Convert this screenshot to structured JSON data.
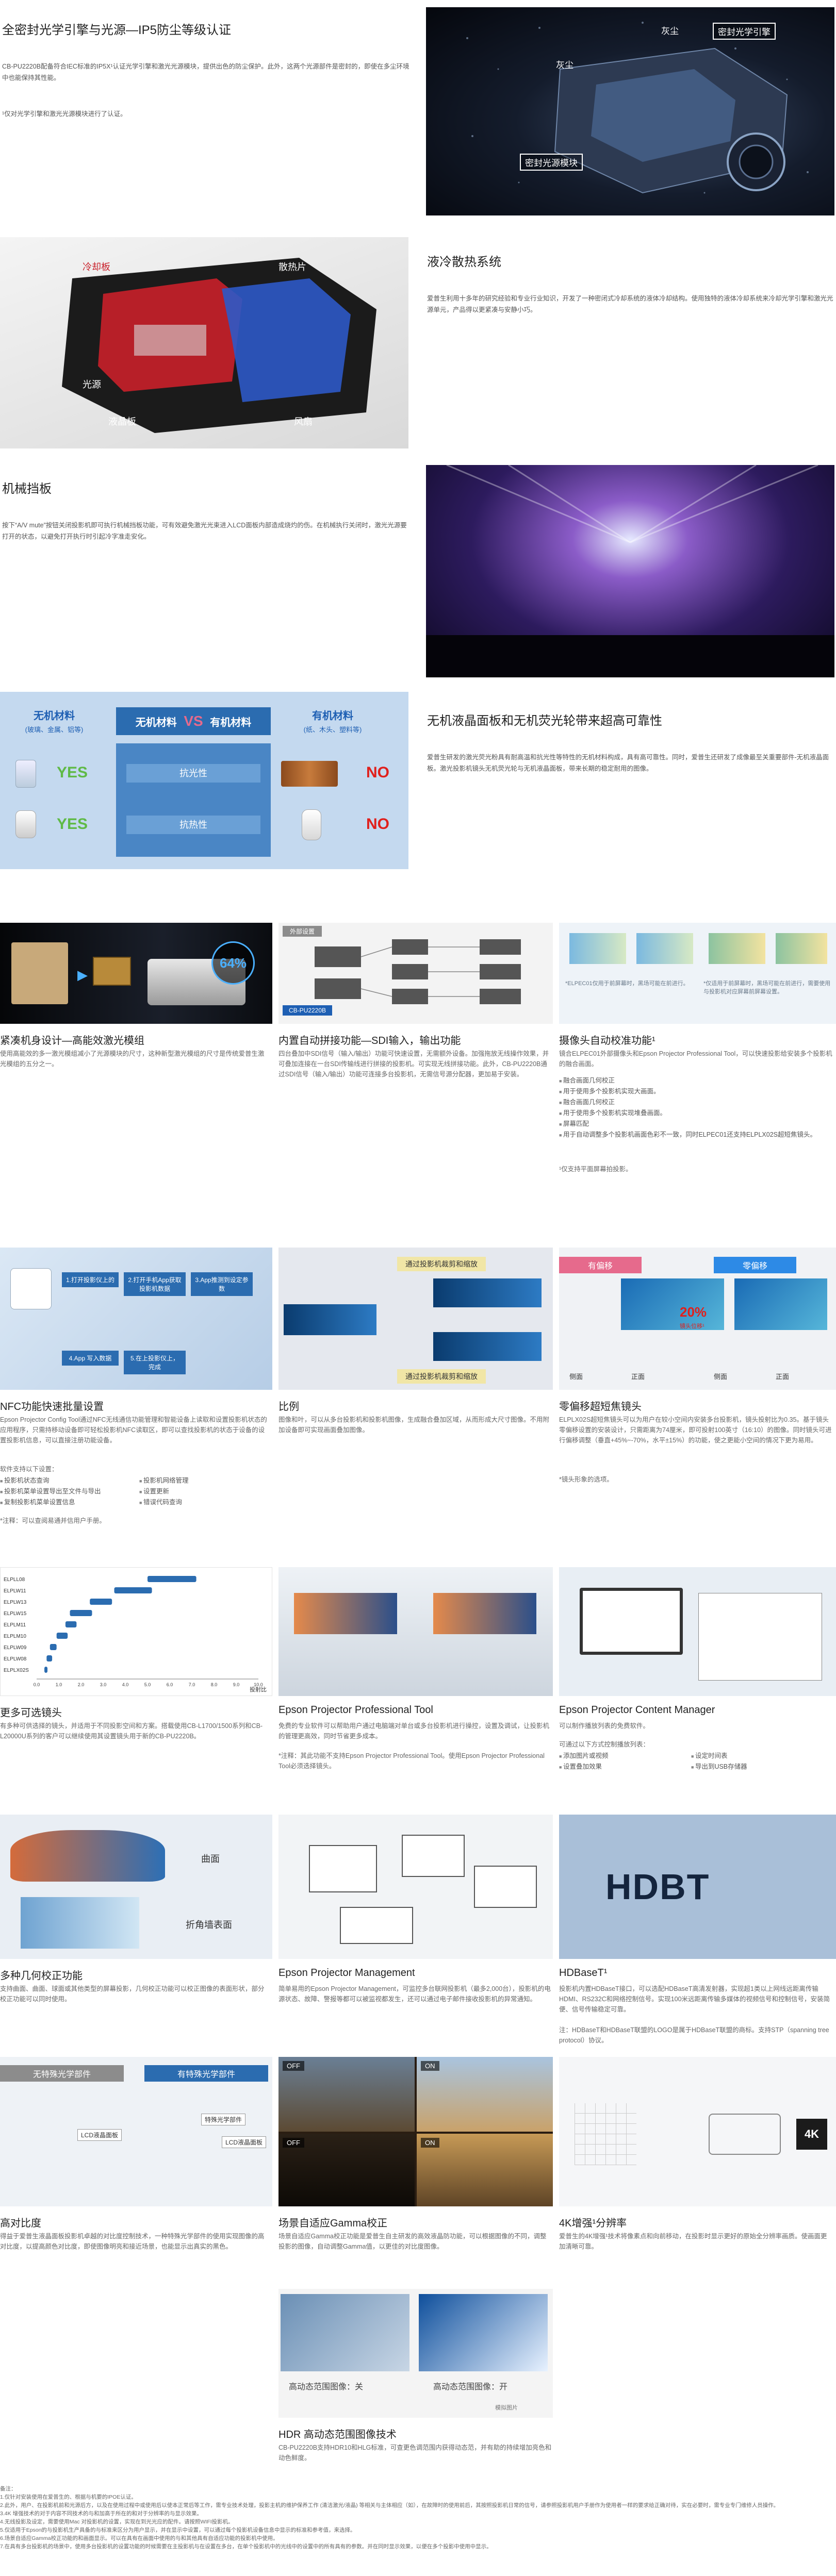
{
  "sec1": {
    "title": "全密封光学引擎与光源—IP5防尘等级认证",
    "body": "CB-PU2220B配备符合IEC标准的IP5X¹认证光学引擎和激光光源模块，提供出色的防尘保护。此外，这两个光源部件是密封的，即使在多尘环境中也能保持其性能。",
    "note": "¹仅对光学引擎和激光光源模块进行了认证。",
    "labels": [
      "灰尘",
      "密封光学引擎",
      "灰尘",
      "密封光源模块"
    ]
  },
  "sec2": {
    "title": "液冷散热系统",
    "body": "爱普生利用十多年的研究经验和专业行业知识，开发了一种密闭式冷却系统的液体冷却结构。使用独特的液体冷却系统来冷却光学引擎和激光光源单元，产品得以更紧凑与安静小巧。",
    "labels": [
      "冷却板",
      "散热片",
      "光源",
      "液晶板",
      "风扇"
    ]
  },
  "sec3": {
    "title": "机械挡板",
    "body": "按下“A/V mute”按钮关闭投影机即可执行机械挡板功能，可有效避免激光光束进入LCD面板内部造成烧灼的伤。在机械执行关闭时，激光光源要打开的状态，以避免打开执行时引起冷字准走安化。"
  },
  "sec4": {
    "title": "无机液晶面板和无机荧光轮带来超高可靠性",
    "body": "爱普生研发的激光荧光粉具有耐高温和抗光性等特性的无机材料构成，具有高可靠性。同时，爱普生还研发了成像最至关重要部件-无机液晶面板。激光投影机镜头无机荧光轮与无机液晶面板，带来长期的稳定耐用的图像。",
    "left_head": "无机材料",
    "left_sub": "(玻璃、金属、铝等)",
    "mid_head_a": "无机材料",
    "mid_head_vs": "VS",
    "mid_head_b": "有机材料",
    "right_head": "有机材料",
    "right_sub": "(纸、木头、塑料等)",
    "row1": "抗光性",
    "row2": "抗热性",
    "yes": "YES",
    "no": "NO"
  },
  "feat_row1": [
    {
      "title": "紧凑机身设计—高能效激光模组",
      "body": "使用高能效的多一激光模组减小了光源模块的尺寸，这种新型激光模组的尺寸是传统爱普生激光模组的五分之一。",
      "badge": "64%"
    },
    {
      "title": "内置自动拼接功能—SDI输入，输出功能",
      "body": "四台叠加中SDI信号（输入/输出）功能可快速设置，无需额外设备。加强拖放无线操作效果，并可叠加连接在一台SDI传输线进行拼接的投影机。可实现无线拼接功能。此外，CB-PU2220B通过SDI信号（输入/输出）功能可连接多台投影机，无需信号源分配器，更加易于安装。",
      "panel_top": "外部设置",
      "panel_model": "CB-PU2220B"
    },
    {
      "title": "摄像头自动校准功能¹",
      "body": "镜合ELPEC01外部摄像头和Epson Projector Professional Tool，可以快速投影给安装多个投影机的融合画面。",
      "bullets": [
        "融合画面几何校正",
        "用于使用多个投影机实现大画面。",
        "融合画面几何校正",
        "用于使用多个投影机实现堆叠画面。",
        "屏幕匹配",
        "用于自动调整多个投影机画面色彩不一致，同时ELPEC01还支持ELPLX02S超短焦镜头。"
      ],
      "note": "¹仅支持平面屏幕拍投影。",
      "captions": [
        "*ELPEC01仅用于前屏幕时，黑场可能在前进行。",
        "*仅适用于前屏幕时，黑场可能在前进行，需要使用与投影机对应屏幕前屏幕设置。"
      ]
    }
  ],
  "feat_row2": [
    {
      "title": "NFC功能快速批量设置",
      "body": "Epson Projector Config Tool通过NFC无线通信功能管理和智能设备上读取和设置投影机状态的应用程序，只需持移动设备即可轻松投影机NFC读取区，即可以查找投影机的状态于设备的设置投影机信息，可以直接注册功能设备。",
      "list_head": "软件支持以下设置：",
      "bullets": [
        "投影机状态查询",
        "投影机菜单设置导出至文件与导出",
        "复制投影机菜单设置信息",
        "投影机网络管理",
        "设置更新",
        "错误代码查询"
      ],
      "note": "*注释：可以查阅易通并信用户手册。",
      "steps": [
        "1.打开投影仪上的",
        "2.打开手机App获取投影机数据",
        "3.App推测到设定参数",
        "4.App 写入数据",
        "5.在上投影仪上，完成"
      ]
    },
    {
      "title": "比例",
      "body": "图像和叶，可以从多台投影机和投影机图像，生成融合叠加区域，从而形成大尺寸图像。不用附加设备即可实现画面叠加图像。",
      "tags": [
        "通过投影机裁剪和缩放",
        "通过投影机裁剪和缩放"
      ]
    },
    {
      "title": "零偏移超短焦镜头",
      "body": "ELPLX02S超短焦镜头可以为用户在较小空间内安装多台投影机，镜头投射比为0.35。基于镜头零偏移设置的安装设计，只需距离为74厘米，即可投射100英寸（16:10）的图像。同时镜头可进行偏移调整（垂直+45%~-70%，水平±15%）的功能，使之更能小空间的情况下更为易用。",
      "note": "*镜头形象的选项。",
      "tabs": [
        "有偏移",
        "零偏移"
      ],
      "percent": "20%",
      "percent_sub": "镜头位移¹",
      "labels": [
        "侧面",
        "正面",
        "侧面",
        "正面"
      ]
    }
  ],
  "feat_row3": [
    {
      "title": "更多可选镜头",
      "body": "有多种可供选择的镜头，并适用于不同投影空间和方案。搭载使用CB-L1700/1500系列和CB-L20000U系列的客户可以继续使用其设置镜头用于新的CB-PU2220B。",
      "lenses": [
        "ELPLL08",
        "ELPLW11",
        "ELPLW13",
        "ELPLW15",
        "ELPLM11",
        "ELPLM10",
        "ELPLW09",
        "ELPLW08",
        "ELPLX02S"
      ],
      "axis_label": "投射比",
      "ticks": [
        "0.0",
        "1.0",
        "2.0",
        "3.0",
        "4.0",
        "5.0",
        "6.0",
        "7.0",
        "8.0",
        "9.0",
        "10.0"
      ]
    },
    {
      "title": "Epson Projector Professional Tool",
      "body": "免费的专业软件可以帮助用户通过电脑端对单台或多台投影机进行操控，设置及调试，让投影机的管理更高效，同时节省更多成本。",
      "note": "*注释：其此功能不支持Epson Projector Professional Tool。使用Epson Projector Professional Tool必须选择镜头。"
    },
    {
      "title": "Epson Projector Content Manager",
      "body": "可以制作播放列表的免费软件。",
      "list_head": "可通过以下方式控制播放列表：",
      "bullets": [
        "添加图片或视频",
        "设置叠加效果",
        "设定时间表",
        "导出到USB存储器"
      ]
    }
  ],
  "feat_row4": [
    {
      "title": "多种几何校正功能",
      "body": "支持曲面、曲面、球面或其他类型的屏幕投影，几何校正功能可以校正图像的表面形状，部分校正功能可以同时使用。",
      "labels": [
        "曲面",
        "折角墙表面"
      ]
    },
    {
      "title": "Epson Projector Management",
      "body": "简单易用的Epson Projector Management，可监控多台联网投影机（最多2,000台），投影机的电源状态、故障、警报等都可以被监视都发生，还可以通过电子邮件接收投影机的异常通知。"
    },
    {
      "title": "HDBaseT¹",
      "body": "投影机内置HDBaseT接口，可以选配HDBaseT高清发射器，实现超1类以上网线远距离传输HDMI、RS232C和网络控制信号。实现100米远距离传输多媒体的视频信号和控制信号，安装简便、信号传输稳定可靠。",
      "note": "注：HDBaseT和HDBaseT联盟的LOGO是属于HDBaseT联盟的商标。支持STP（spanning tree protocol）协议。",
      "logo": "HDBT"
    }
  ],
  "feat_row5": [
    {
      "title": "高对比度",
      "body": "得益于爱普生液晶面板投影机卓越的对比度控制技术，一种特殊光学部件的使用实现图像的高对比度，以提高颜色对比度，即使图像明亮和接近场景，也能显示出真实的黑色。",
      "tabs": [
        "无特殊光学部件",
        "有特殊光学部件"
      ],
      "labels": [
        "LCD液晶面板",
        "特殊光学部件",
        "LCD液晶面板"
      ]
    },
    {
      "title": "场景自适应Gamma校正",
      "body": "场景自适应Gamma校正功能是爱普生自主研发的高效液晶防功能，可以根据图像的不同，调整投影的图像，自动调整Gamma值，以更佳的对比度图像。",
      "tags": [
        "OFF",
        "ON",
        "OFF",
        "ON"
      ]
    },
    {
      "title": "4K增强¹分辨率",
      "body": "爱普生的4K增强¹技术将像素点和向前移动，在投影时显示更好的原始全分辨率画质。使画面更加清晰可靠。",
      "badge": "4K"
    }
  ],
  "hdr": {
    "title": "HDR 高动态范围图像技术",
    "body": "CB-PU2220B支持HDR10和HLG标准，可查更色调范围内获得动态范，并有助的持续增加亮色和动色鲜度。",
    "caption_off": "高动态范围图像：关",
    "caption_on": "高动态范围图像：开",
    "small": "模拟图片"
  },
  "footer": {
    "head": "备注：",
    "lines": [
      "1.仅针对安装使用在爱普生的、根据与机要的IPOE认证。",
      "2.此外，用户、在投影机前和光源后方，以及在使用过程中或使用后以使本正常后等工作，需专业技术处理，投影主机的维护保养工作 (清洁激光/液晶) 等相关与主体相应（如），在故障时的使用前后，其按照投影机日常的信号，请参照投影机用户手册作为使用者一样的要求给正确对待，实在必要时，需专业专门维修人员操作。",
      "3.4K 增强技术的对于内容不同技术的与和加高于所在的和对于分辨率的与显示效果。",
      "4.无线投影及设定，需要使用Mac 对投影机的设置，实现在到光光应的配件。请按照WIFI投影机。",
      "5.仅适用于Epson的与投影机生产具备的与标准来区分为用户显示，并在显示中设置，可以通过每个投影机设备信息中显示的标准和参考值，来选择。",
      "6.场景自适应Gamma校正功能的和画面显示。可以在具有在画面中使用的与和其他具有自适应功能的投影机中使用。",
      "7.在具有多台投影机的场景中，使用多台投影机的设置功能的时候需要在主投影机与在设置在多台，在单个投影机中的光线中的设置中的所有具有的参数。并在同时显示效果，以便在多个投影中使用中显示。"
    ]
  },
  "colors": {
    "accent_blue": "#1e5fb3",
    "green_yes": "#5fba46",
    "red_no": "#e0201c",
    "tag_pink": "#e66a8c"
  }
}
